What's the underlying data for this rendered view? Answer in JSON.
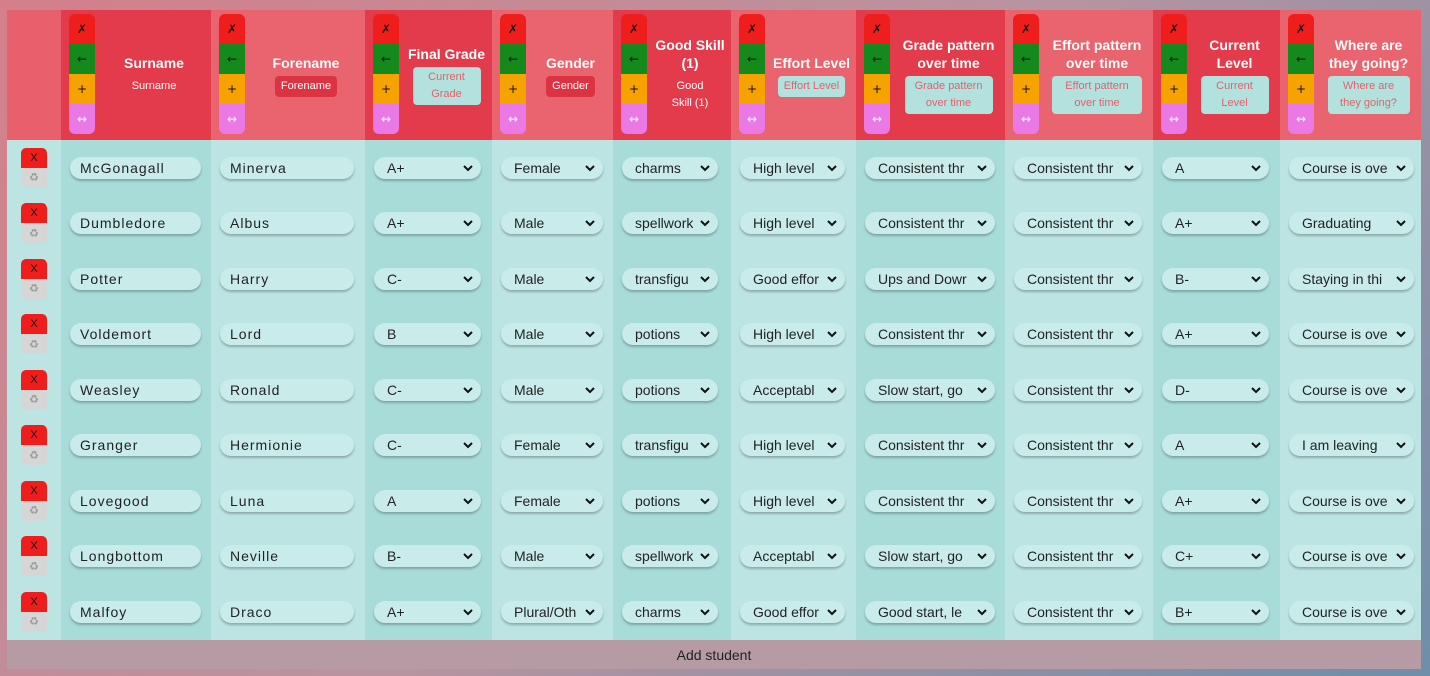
{
  "header": {
    "columns": [
      {
        "title": "Surname",
        "input": "Surname",
        "style": "none"
      },
      {
        "title": "Forename",
        "input": "Forename",
        "style": "red"
      },
      {
        "title": "Final Grade",
        "input": "Current Grade",
        "style": "teal"
      },
      {
        "title": "Gender",
        "input": "Gender",
        "style": "red"
      },
      {
        "title": "Good Skill (1)",
        "input": "Good Skill (1)",
        "style": "none"
      },
      {
        "title": "Effort Level",
        "input": "Effort Level",
        "style": "teal"
      },
      {
        "title": "Grade pattern over time",
        "input": "Grade pattern over time",
        "style": "teal"
      },
      {
        "title": "Effort pattern over time",
        "input": "Effort pattern over time",
        "style": "teal"
      },
      {
        "title": "Current Level",
        "input": "Current Level",
        "style": "teal"
      },
      {
        "title": "Where are they going?",
        "input": "Where are they going?",
        "style": "teal"
      }
    ],
    "controls": {
      "delete": "✗",
      "move_left": "←",
      "add": "+",
      "widen": "↔"
    }
  },
  "row_controls": {
    "delete": "X",
    "reset": "♻"
  },
  "rows": [
    {
      "surname": "McGonagall",
      "forename": "Minerva",
      "grade": "A+",
      "gender": "Female",
      "skill": "charms",
      "effort": "High level",
      "grade_pattern": "Consistent thr",
      "effort_pattern": "Consistent thr",
      "level": "A",
      "going": "Course is ove"
    },
    {
      "surname": "Dumbledore",
      "forename": "Albus",
      "grade": "A+",
      "gender": "Male",
      "skill": "spellwork",
      "effort": "High level",
      "grade_pattern": "Consistent thr",
      "effort_pattern": "Consistent thr",
      "level": "A+",
      "going": "Graduating"
    },
    {
      "surname": "Potter",
      "forename": "Harry",
      "grade": "C-",
      "gender": "Male",
      "skill": "transfigu",
      "effort": "Good effor",
      "grade_pattern": "Ups and Dowr",
      "effort_pattern": "Consistent thr",
      "level": "B-",
      "going": "Staying in thi"
    },
    {
      "surname": "Voldemort",
      "forename": "Lord",
      "grade": "B",
      "gender": "Male",
      "skill": "potions",
      "effort": "High level",
      "grade_pattern": "Consistent thr",
      "effort_pattern": "Consistent thr",
      "level": "A+",
      "going": "Course is ove"
    },
    {
      "surname": "Weasley",
      "forename": "Ronald",
      "grade": "C-",
      "gender": "Male",
      "skill": "potions",
      "effort": "Acceptabl",
      "grade_pattern": "Slow start, go",
      "effort_pattern": "Consistent thr",
      "level": "D-",
      "going": "Course is ove"
    },
    {
      "surname": "Granger",
      "forename": "Hermionie",
      "grade": "C-",
      "gender": "Female",
      "skill": "transfigu",
      "effort": "High level",
      "grade_pattern": "Consistent thr",
      "effort_pattern": "Consistent thr",
      "level": "A",
      "going": "I am leaving"
    },
    {
      "surname": "Lovegood",
      "forename": "Luna",
      "grade": "A",
      "gender": "Female",
      "skill": "potions",
      "effort": "High level",
      "grade_pattern": "Consistent thr",
      "effort_pattern": "Consistent thr",
      "level": "A+",
      "going": "Course is ove"
    },
    {
      "surname": "Longbottom",
      "forename": "Neville",
      "grade": "B-",
      "gender": "Male",
      "skill": "spellwork",
      "effort": "Acceptabl",
      "grade_pattern": "Slow start, go",
      "effort_pattern": "Consistent thr",
      "level": "C+",
      "going": "Course is ove"
    },
    {
      "surname": "Malfoy",
      "forename": "Draco",
      "grade": "A+",
      "gender": "Plural/Oth",
      "skill": "charms",
      "effort": "Good effor",
      "grade_pattern": "Good start, le",
      "effort_pattern": "Consistent thr",
      "level": "B+",
      "going": "Course is ove"
    }
  ],
  "footer": {
    "add_label": "Add student"
  },
  "colors": {
    "header_dark": "#e33b4c",
    "header_light": "#e9646f",
    "body_dark": "#a7dcd9",
    "body_light": "#bce4e2"
  }
}
